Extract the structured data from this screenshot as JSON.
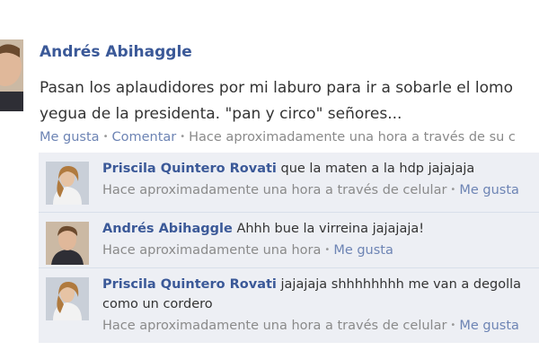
{
  "post": {
    "author": "Andrés Abihaggle",
    "text_line1": "Pasan los aplaudidores por mi laburo para ir a sobarle el lomo",
    "text_line2": "yegua de la presidenta. \"pan y circo\" señores...",
    "actions": {
      "like": "Me gusta",
      "comment": "Comentar",
      "time": "Hace aproximadamente una hora a través de su c"
    }
  },
  "comments": [
    {
      "author": "Priscila Quintero Rovati",
      "text": "que la maten a la hdp jajajaja",
      "time": "Hace aproximadamente una hora a través de celular",
      "like": "Me gusta"
    },
    {
      "author": "Andrés Abihaggle",
      "text": "Ahhh bue la virreina jajajaja!",
      "time": "Hace aproximadamente una hora",
      "like": "Me gusta"
    },
    {
      "author": "Priscila Quintero Rovati",
      "text": "jajajaja shhhhhhhh me van a degolla",
      "text_line2": "como un cordero",
      "time": "Hace aproximadamente una hora a través de celular",
      "like": "Me gusta"
    }
  ]
}
